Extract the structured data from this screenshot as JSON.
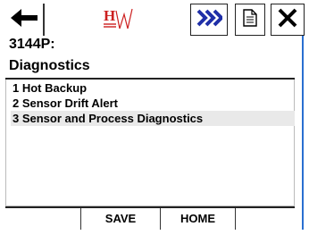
{
  "toolbar": {
    "back_icon": "left-arrow-icon",
    "logo_icon": "hart-logo-icon",
    "next_icon": "double-chevron-right-icon",
    "document_icon": "document-icon",
    "close_icon": "close-x-icon"
  },
  "header": {
    "device_tag": "3144P:",
    "title": "Diagnostics"
  },
  "menu": {
    "items": [
      {
        "label": "1 Hot Backup",
        "selected": false
      },
      {
        "label": "2 Sensor Drift Alert",
        "selected": false
      },
      {
        "label": "3 Sensor and Process Diagnostics",
        "selected": true
      }
    ]
  },
  "footer": {
    "save_label": "SAVE",
    "home_label": "HOME"
  },
  "colors": {
    "accent_blue": "#2a6fd1",
    "logo_red": "#cc1f1f",
    "selected_bg": "#e9e9e9"
  }
}
